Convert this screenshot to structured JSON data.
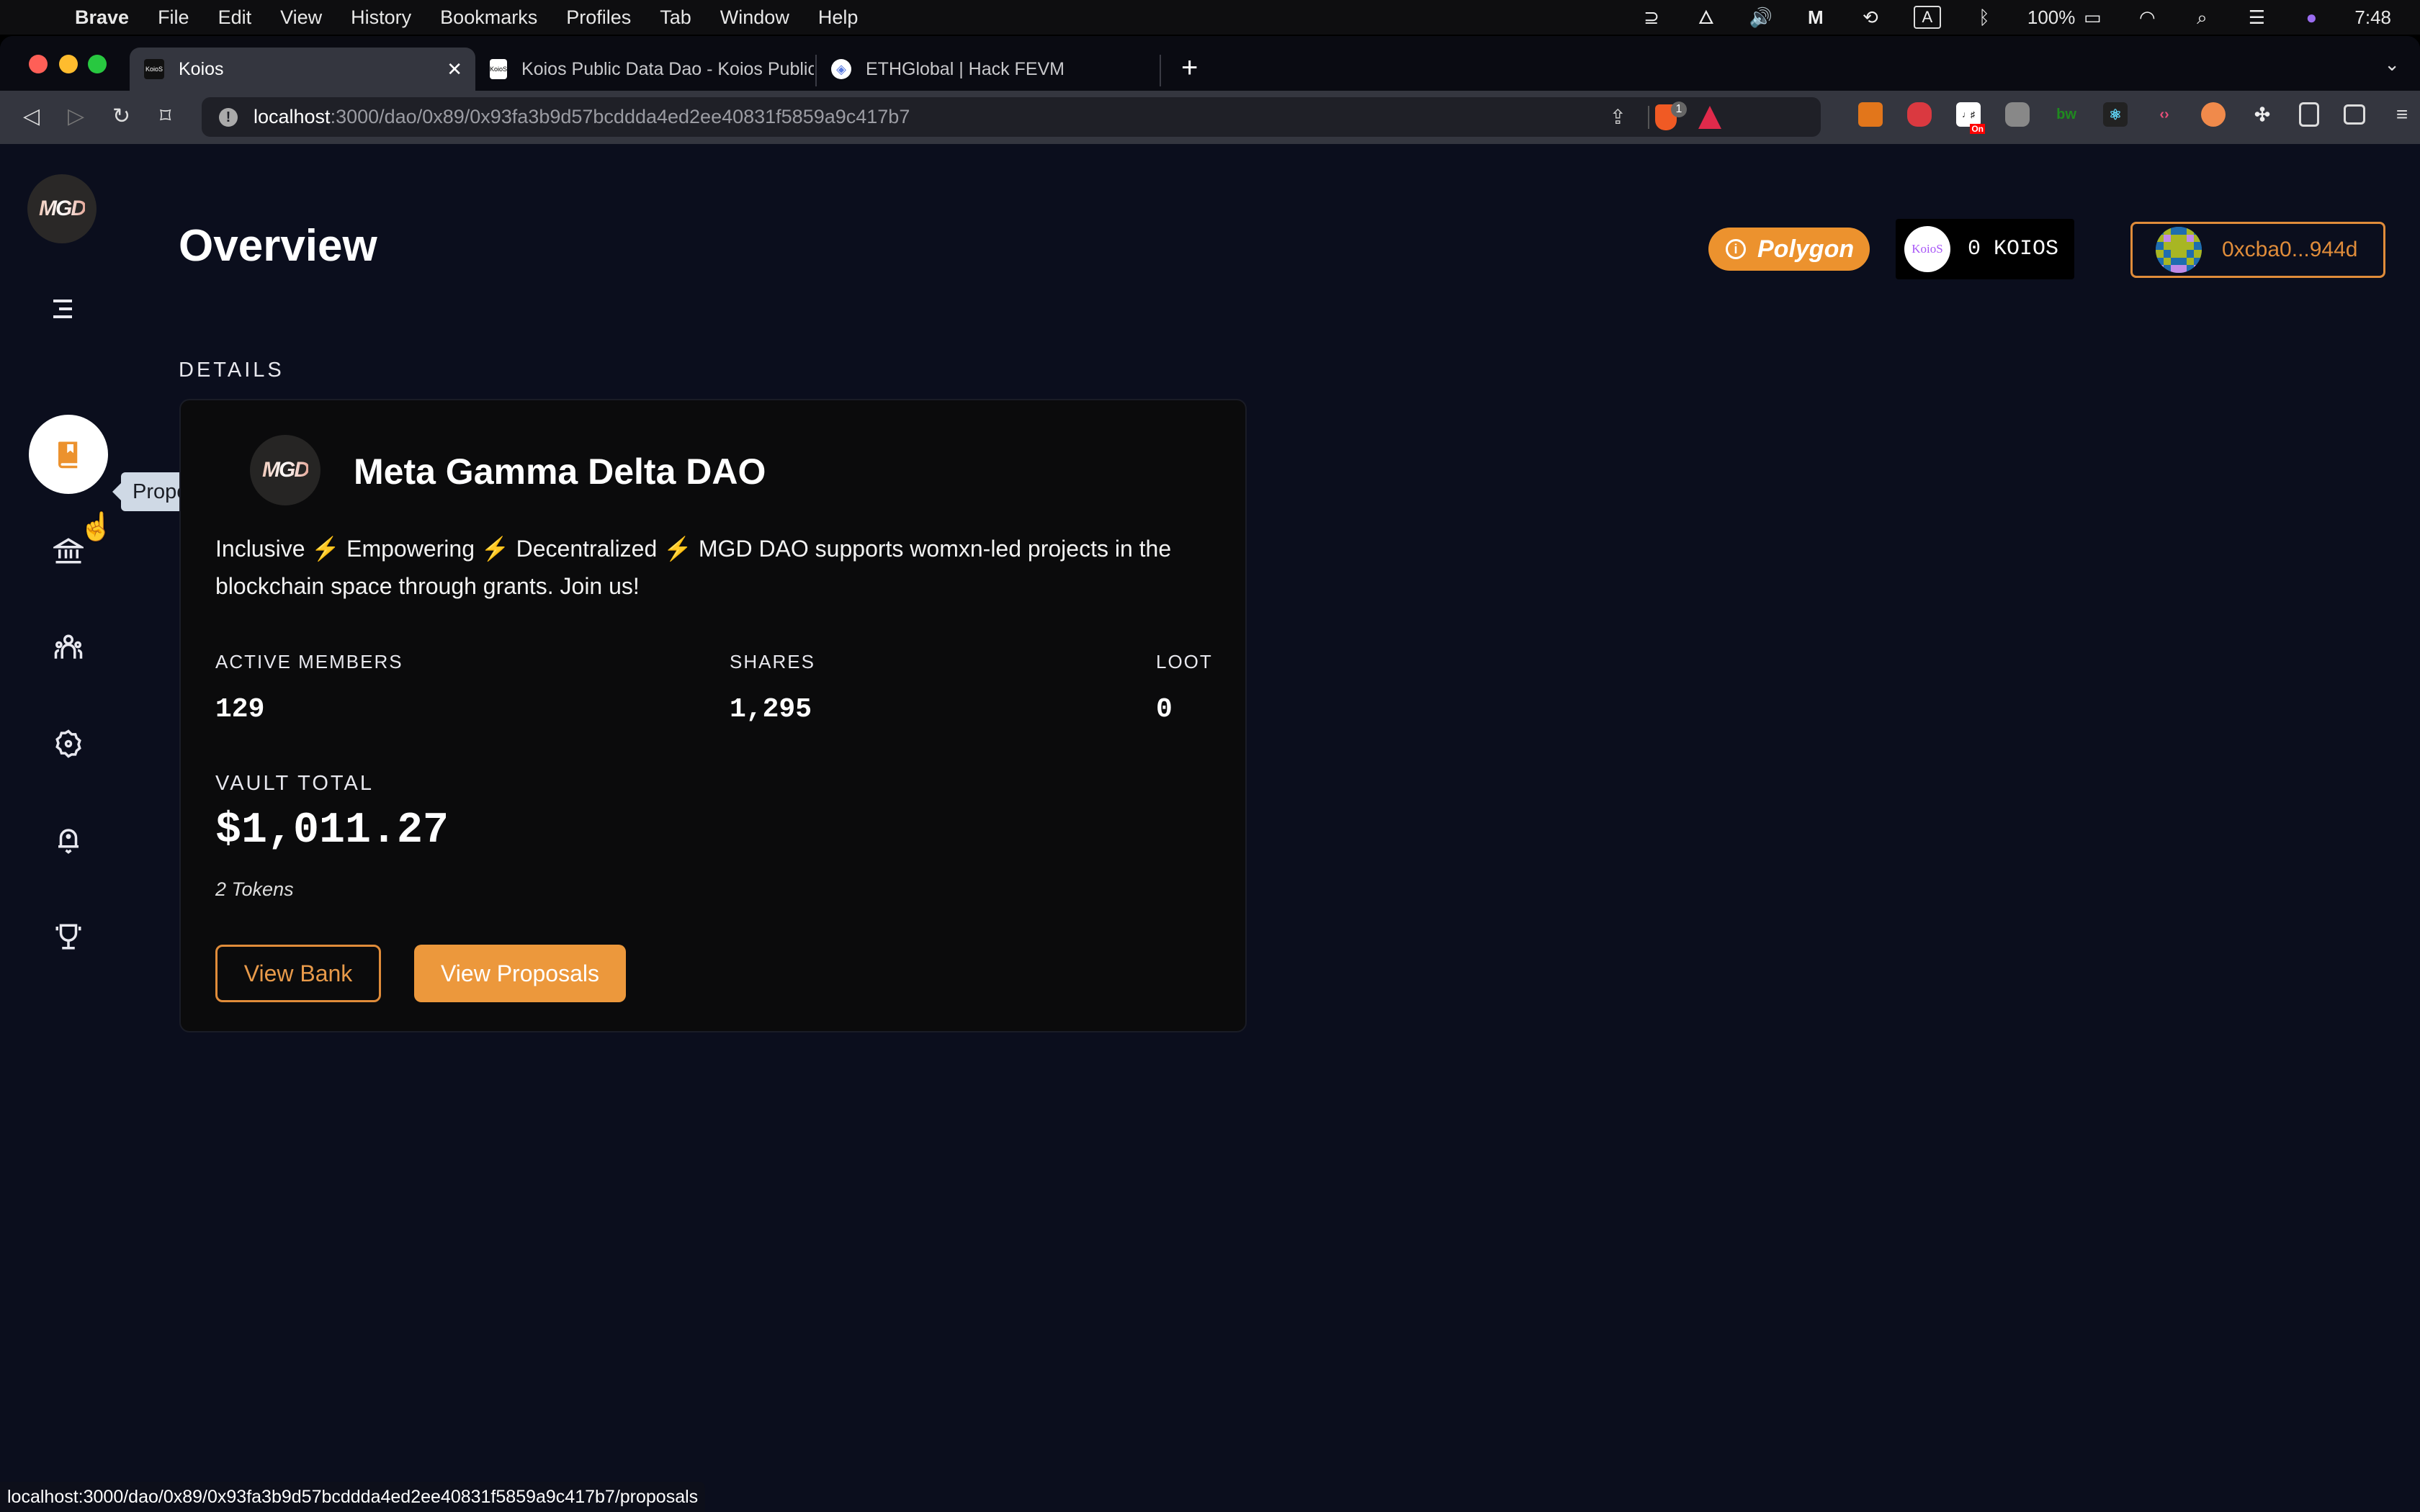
{
  "menubar": {
    "app_name": "Brave",
    "items": [
      "File",
      "Edit",
      "View",
      "History",
      "Bookmarks",
      "Profiles",
      "Tab",
      "Window",
      "Help"
    ],
    "battery": "100%",
    "clock": "7:48",
    "input_source": "A"
  },
  "browser": {
    "tabs": [
      {
        "title": "Koios",
        "active": true
      },
      {
        "title": "Koios Public Data Dao - Koios Public",
        "active": false
      },
      {
        "title": "ETHGlobal | Hack FEVM",
        "active": false
      }
    ],
    "url_host": "localhost",
    "url_path": ":3000/dao/0x89/0x93fa3b9d57bcddda4ed2ee40831f5859a9c417b7",
    "brave_shield_count": "1",
    "status_url": "localhost:3000/dao/0x89/0x93fa3b9d57bcddda4ed2ee40831f5859a9c417b7/proposals"
  },
  "sidebar": {
    "logo_text": "MGD",
    "items": [
      {
        "name": "proposals",
        "icon": "book-bookmark-icon",
        "active": true
      },
      {
        "name": "vaults",
        "icon": "bank-icon",
        "active": false
      },
      {
        "name": "members",
        "icon": "people-icon",
        "active": false
      },
      {
        "name": "settings",
        "icon": "gear-icon",
        "active": false
      },
      {
        "name": "notifications",
        "icon": "bell-icon",
        "active": false
      },
      {
        "name": "leaderboard",
        "icon": "trophy-icon",
        "active": false
      }
    ],
    "tooltip": "Proposals"
  },
  "header": {
    "title": "Overview",
    "network": "Polygon",
    "koios_logo_text": "KoioS",
    "koios_balance": "0 KOIOS",
    "wallet_address": "0xcba0...944d"
  },
  "colors": {
    "accent": "#EC922E",
    "background": "#0B0E1D",
    "card": "#0B0B0C"
  },
  "details": {
    "section_label": "DETAILS",
    "dao_logo_text": "MGD",
    "dao_name": "Meta Gamma Delta DAO",
    "description": "Inclusive ⚡ Empowering ⚡ Decentralized ⚡ MGD DAO supports womxn-led projects in the blockchain space through grants. Join us!",
    "stats": {
      "active_members_label": "ACTIVE MEMBERS",
      "active_members": "129",
      "shares_label": "SHARES",
      "shares": "1,295",
      "loot_label": "LOOT",
      "loot": "0"
    },
    "vault_label": "VAULT TOTAL",
    "vault_total": "$1,011.27",
    "token_count": "2 Tokens",
    "view_bank_label": "View Bank",
    "view_proposals_label": "View Proposals"
  }
}
